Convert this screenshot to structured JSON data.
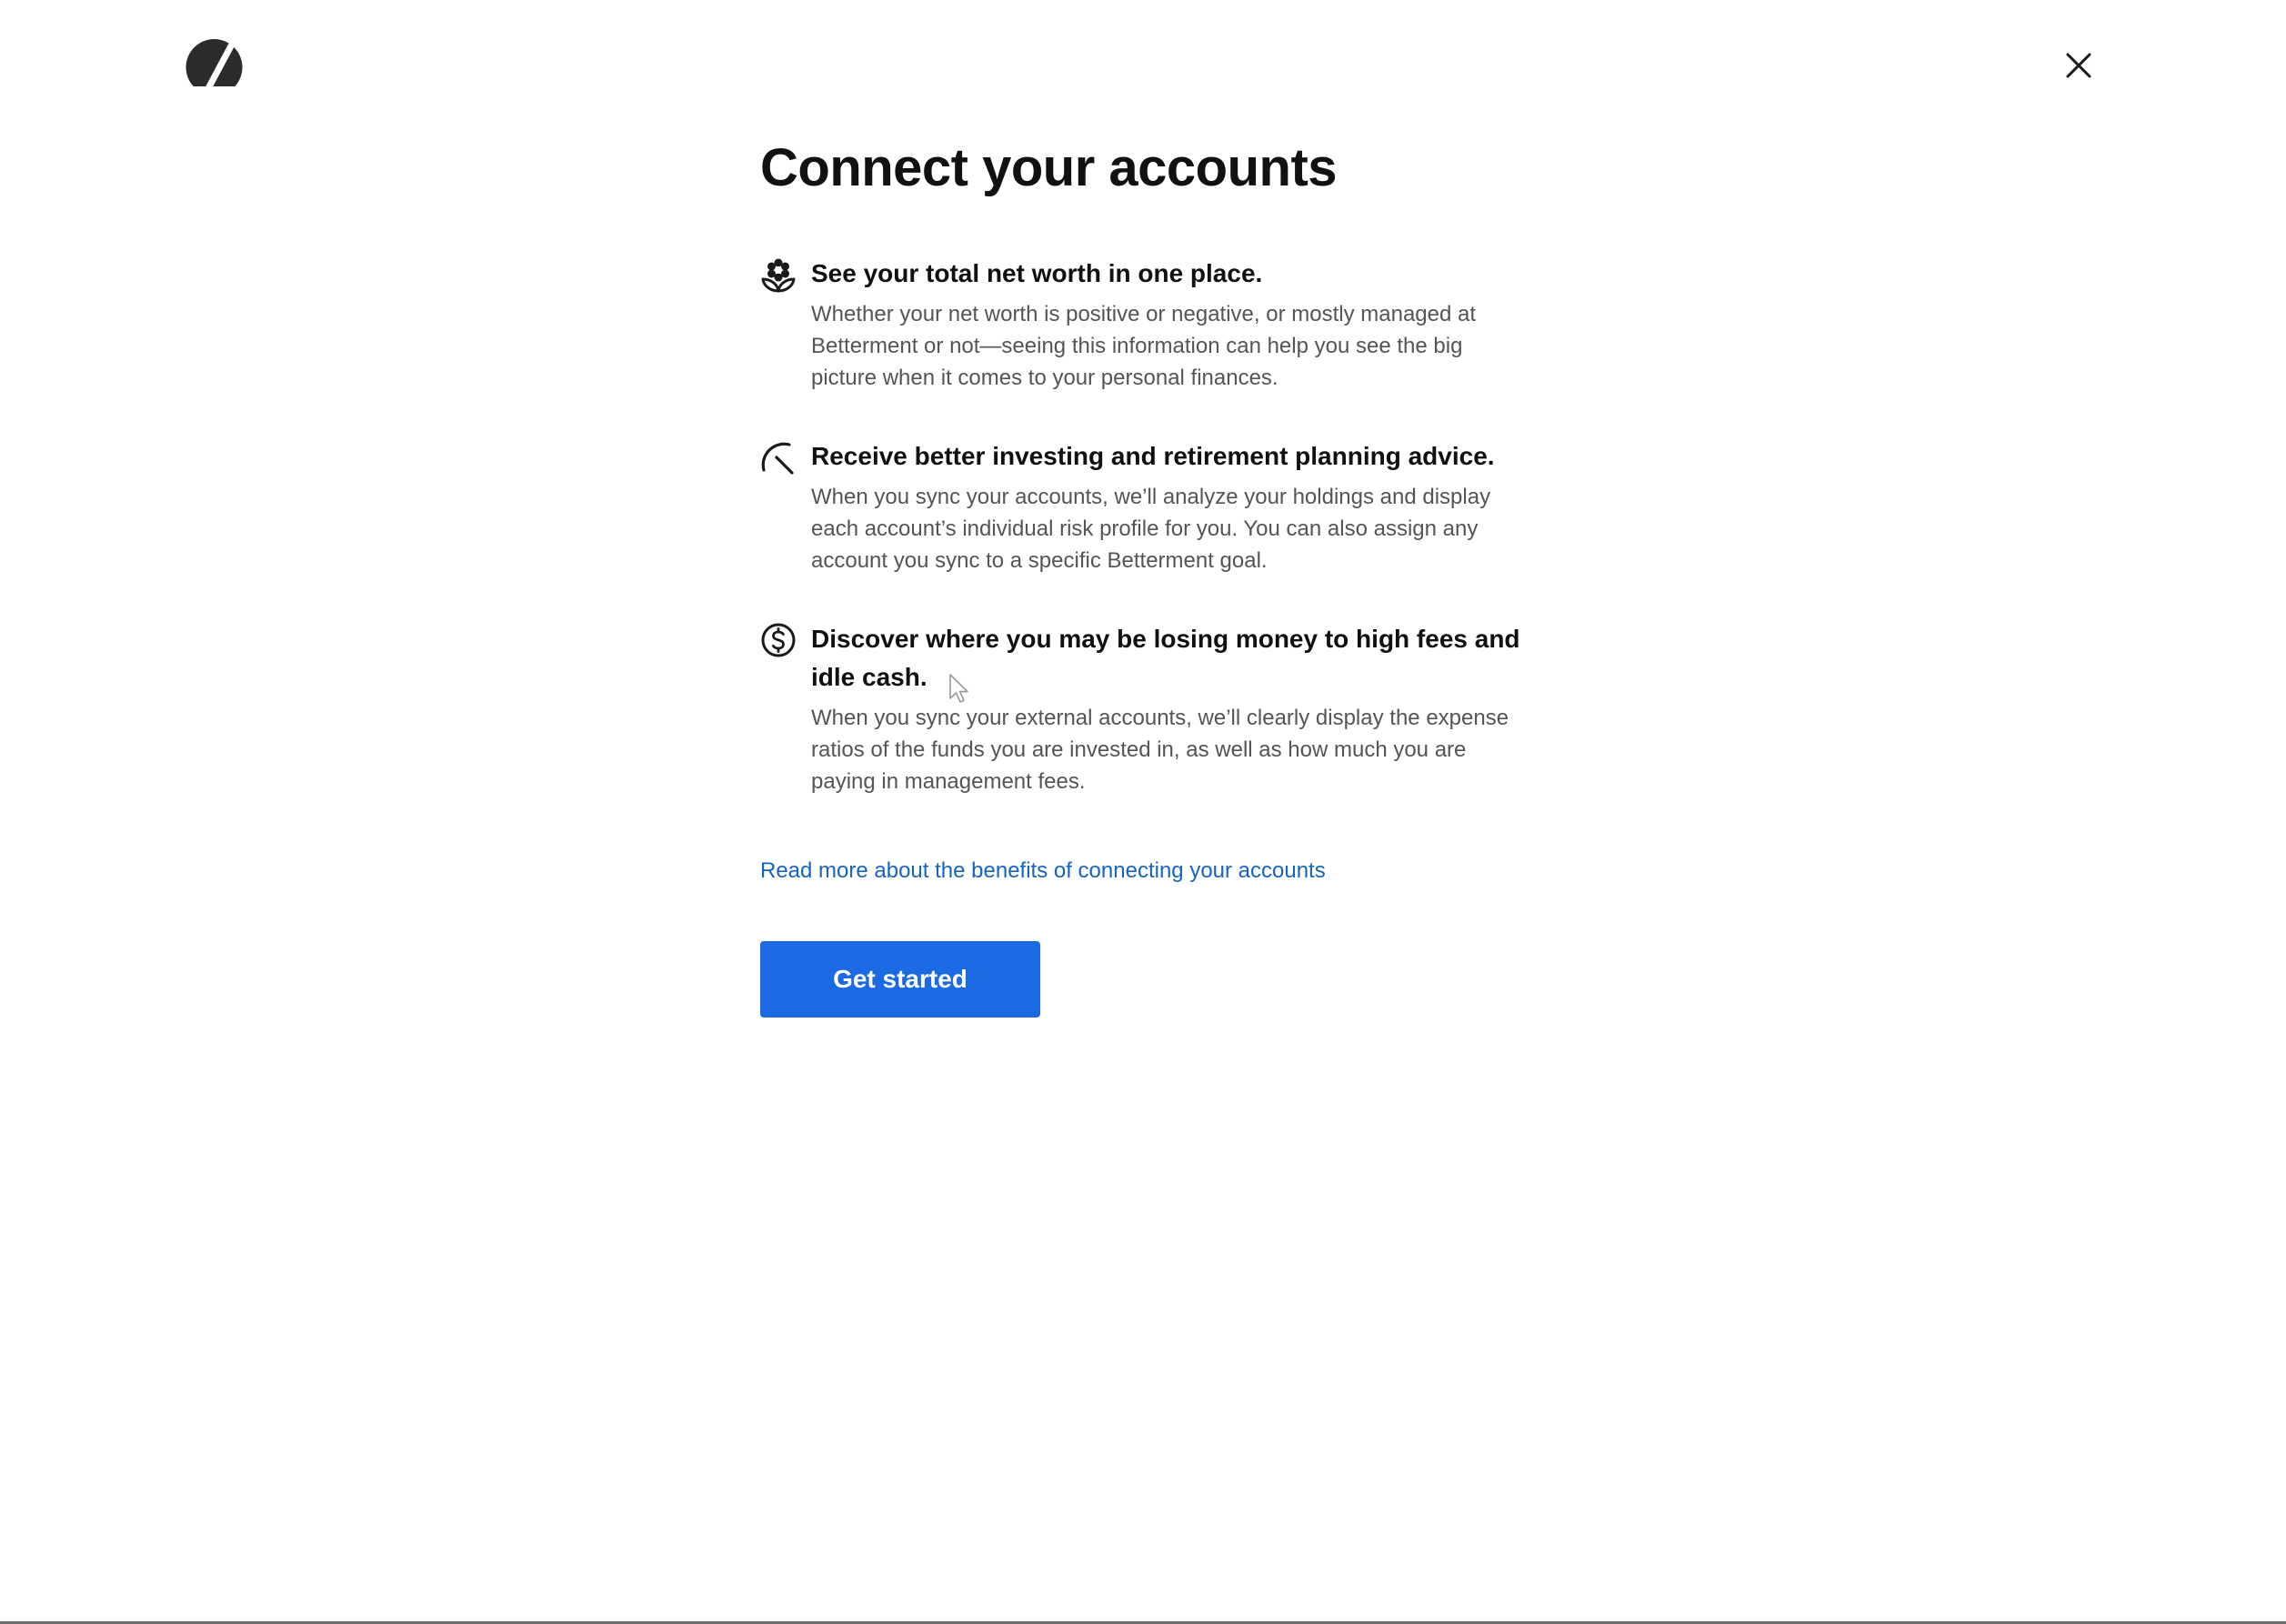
{
  "header": {
    "logo_icon": "betterment-logo-icon",
    "close_icon": "close-icon"
  },
  "main": {
    "title": "Connect your accounts",
    "features": [
      {
        "icon": "flower-icon",
        "heading": "See your total net worth in one place.",
        "body": "Whether your net worth is positive or negative, or mostly managed at Betterment or not—seeing this information can help you see the big picture when it comes to your personal finances."
      },
      {
        "icon": "gauge-icon",
        "heading": "Receive better investing and retirement planning advice.",
        "body": "When you sync your accounts, we’ll analyze your holdings and display each account’s individual risk profile for you. You can also assign any account you sync to a specific Betterment goal."
      },
      {
        "icon": "dollar-circle-icon",
        "heading": "Discover where you may be losing money to high fees and idle cash.",
        "body": "When you sync your external accounts, we’ll clearly display the expense ratios of the funds you are invested in, as well as how much you are paying in management fees."
      }
    ],
    "link_text": "Read more about the benefits of connecting your accounts",
    "cta_label": "Get started"
  },
  "colors": {
    "accent": "#1b6ae4",
    "link": "#1565c0",
    "heading": "#111111",
    "body_text": "#555555"
  }
}
